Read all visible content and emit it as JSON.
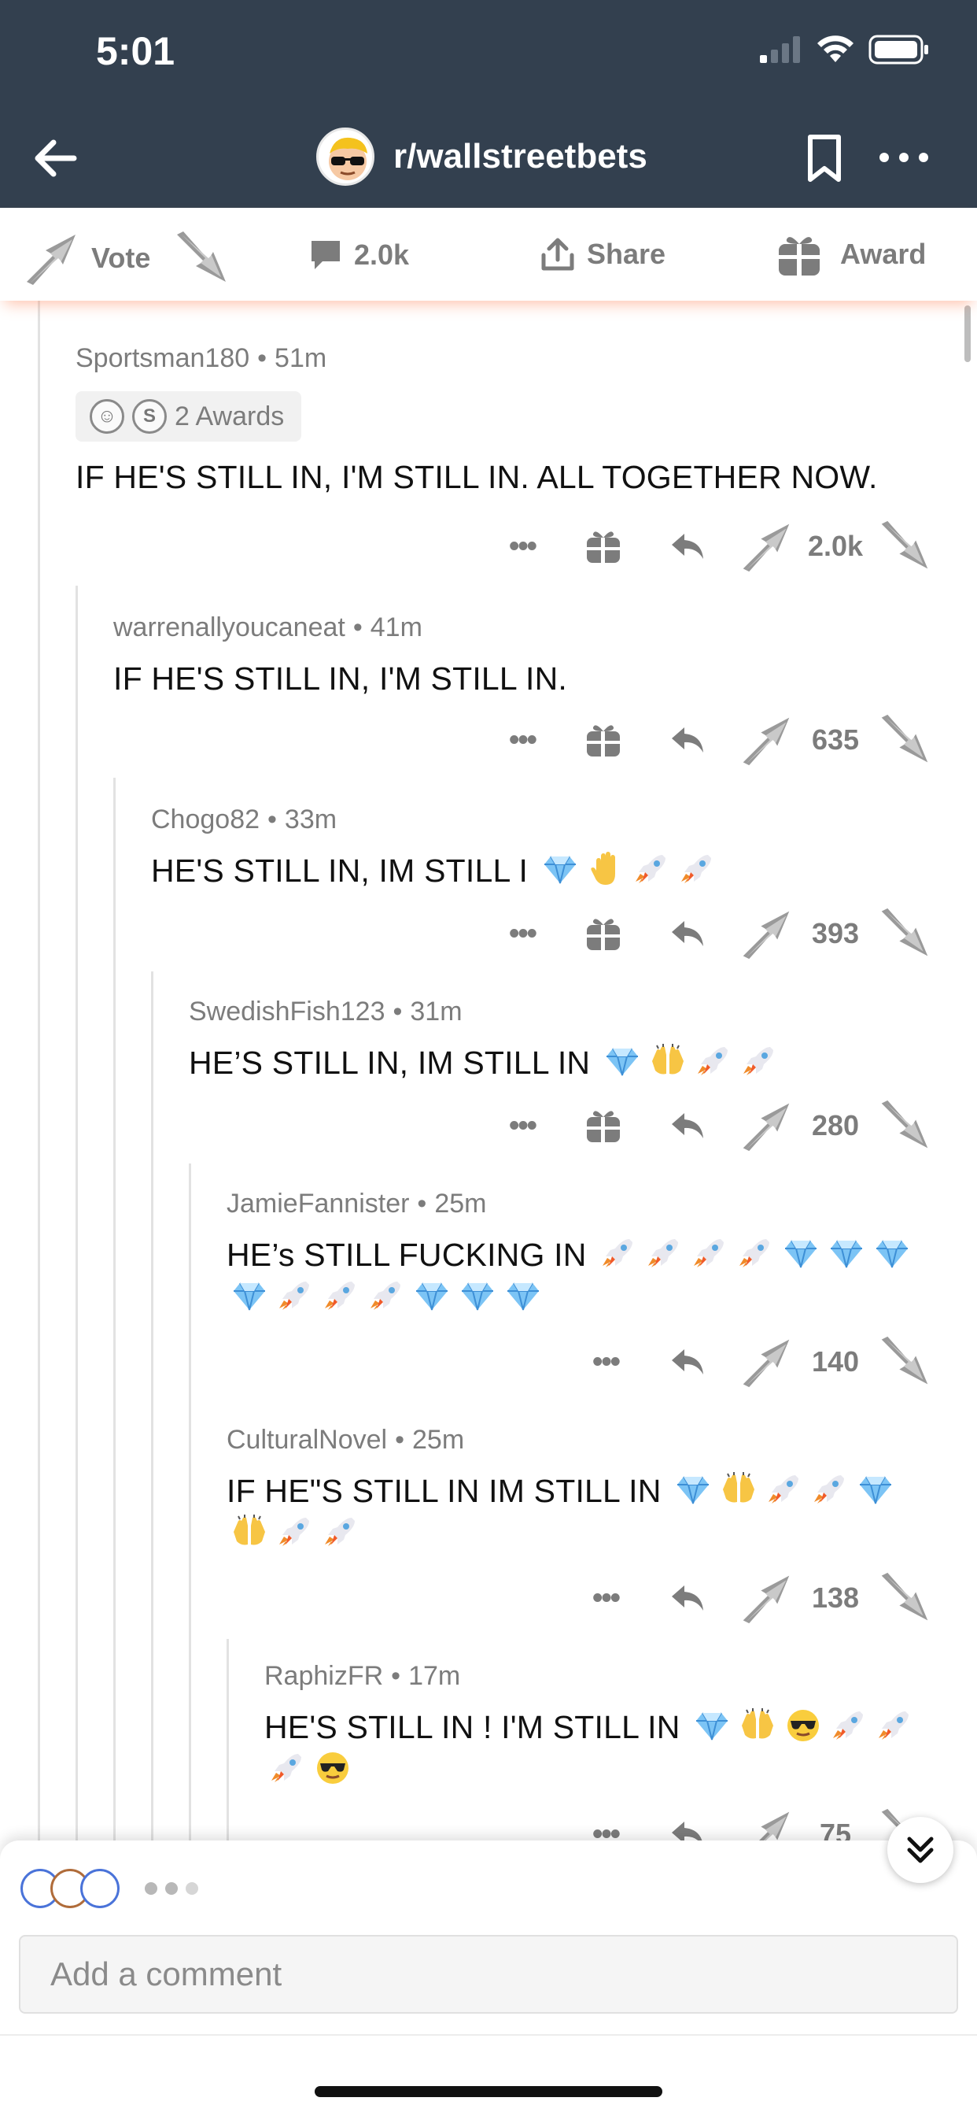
{
  "status_bar": {
    "time": "5:01"
  },
  "nav": {
    "title": "r/wallstreetbets"
  },
  "post_actions": {
    "vote_label": "Vote",
    "comments_count": "2.0k",
    "share_label": "Share",
    "award_label": "Award"
  },
  "comments": [
    {
      "author": "Sportsman180",
      "age": "51m",
      "awards": "2 Awards",
      "text": "IF HE'S STILL IN, I'M STILL IN. ALL TOGETHER NOW.",
      "score": "2.0k",
      "emoji": []
    },
    {
      "author": "warrenallyoucaneat",
      "age": "41m",
      "text": "IF HE'S STILL IN, I'M STILL IN.",
      "score": "635",
      "emoji": []
    },
    {
      "author": "Chogo82",
      "age": "33m",
      "text": "HE'S STILL IN, IM STILL I",
      "score": "393",
      "emoji": [
        "diamond",
        "hand",
        "rocket",
        "rocket"
      ]
    },
    {
      "author": "SwedishFish123",
      "age": "31m",
      "text": "HE’S STILL IN, IM STILL IN",
      "score": "280",
      "emoji": [
        "diamond",
        "hands",
        "rocket",
        "rocket"
      ]
    },
    {
      "author": "JamieFannister",
      "age": "25m",
      "text": "HE’s STILL FUCKING IN",
      "score": "140",
      "emoji": [
        "rocket",
        "rocket",
        "rocket",
        "rocket",
        "diamond",
        "diamond",
        "diamond",
        "diamond",
        "rocket",
        "rocket",
        "rocket",
        "diamond",
        "diamond",
        "diamond"
      ]
    },
    {
      "author": "CulturalNovel",
      "age": "25m",
      "text": "IF HE\"S STILL IN IM STILL IN",
      "score": "138",
      "emoji": [
        "diamond",
        "hands",
        "rocket",
        "rocket",
        "diamond",
        "hands",
        "rocket",
        "rocket"
      ]
    },
    {
      "author": "RaphizFR",
      "age": "17m",
      "text": "HE'S STILL IN ! I'M STILL IN",
      "score": "75",
      "emoji": [
        "diamond",
        "hands",
        "cool",
        "rocket",
        "rocket",
        "rocket",
        "cool"
      ]
    }
  ],
  "composer": {
    "placeholder": "Add a comment"
  },
  "colors": {
    "header_bg": "#33404f",
    "meta_gray": "#7c7c7c",
    "thread_line": "#e2e2e2"
  }
}
